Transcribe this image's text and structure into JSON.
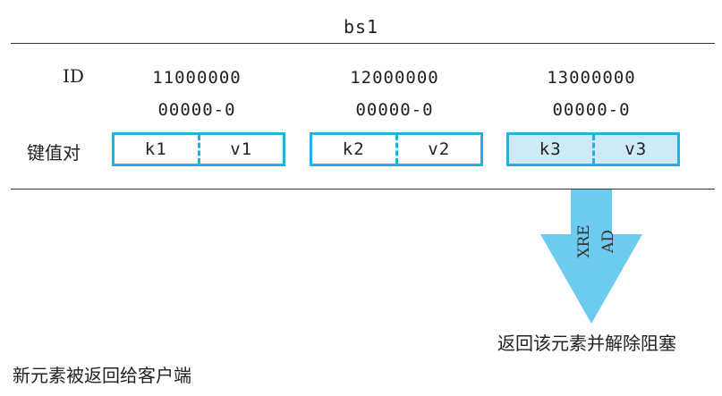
{
  "stream_name": "bs1",
  "id_label": "ID",
  "kv_label": "键值对",
  "entries": [
    {
      "id_line1": "11000000",
      "id_line2": "00000-0",
      "key": "k1",
      "value": "v1",
      "highlighted": false
    },
    {
      "id_line1": "12000000",
      "id_line2": "00000-0",
      "key": "k2",
      "value": "v2",
      "highlighted": false
    },
    {
      "id_line1": "13000000",
      "id_line2": "00000-0",
      "key": "k3",
      "value": "v3",
      "highlighted": true
    }
  ],
  "arrow": {
    "line1": "XRE",
    "line2": "AD",
    "color": "#6ccbee"
  },
  "result_caption": "返回该元素并解除阻塞",
  "new_element_caption": "新元素被返回给客户端",
  "colors": {
    "border": "#29aee0",
    "highlight_fill": "#cdeaf6",
    "arrow_fill": "#6ccbee"
  }
}
